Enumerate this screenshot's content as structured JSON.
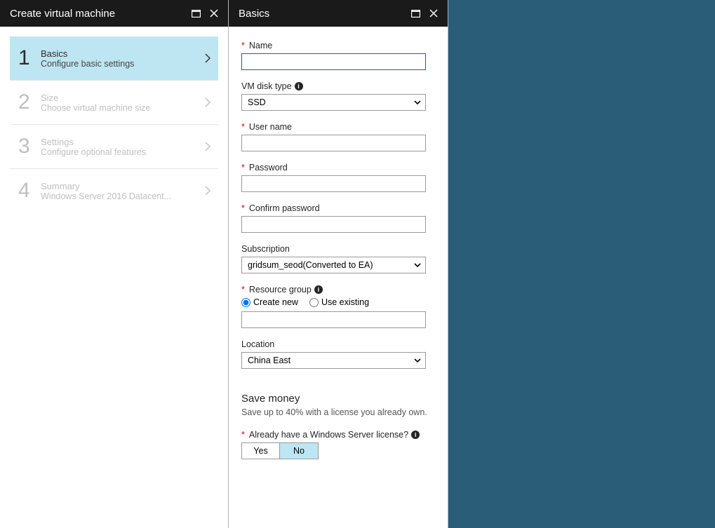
{
  "blade1": {
    "title": "Create virtual machine",
    "steps": [
      {
        "num": "1",
        "title": "Basics",
        "sub": "Configure basic settings",
        "active": true
      },
      {
        "num": "2",
        "title": "Size",
        "sub": "Choose virtual machine size",
        "active": false
      },
      {
        "num": "3",
        "title": "Settings",
        "sub": "Configure optional features",
        "active": false
      },
      {
        "num": "4",
        "title": "Summary",
        "sub": "Windows Server 2016 Datacent...",
        "active": false
      }
    ]
  },
  "blade2": {
    "title": "Basics",
    "labels": {
      "name": "Name",
      "diskType": "VM disk type",
      "userName": "User name",
      "password": "Password",
      "confirmPassword": "Confirm password",
      "subscription": "Subscription",
      "resourceGroup": "Resource group",
      "createNew": "Create new",
      "useExisting": "Use existing",
      "location": "Location",
      "saveMoney": "Save money",
      "saveMoneySub": "Save up to 40% with a license you already own.",
      "licenseQ": "Already have a Windows Server license?",
      "yes": "Yes",
      "no": "No"
    },
    "values": {
      "name": "",
      "diskType": "SSD",
      "userName": "",
      "password": "",
      "confirmPassword": "",
      "subscription": "gridsum_seod(Converted to EA)",
      "resourceGroup": "",
      "location": "China East",
      "licenseSelected": "No"
    }
  }
}
